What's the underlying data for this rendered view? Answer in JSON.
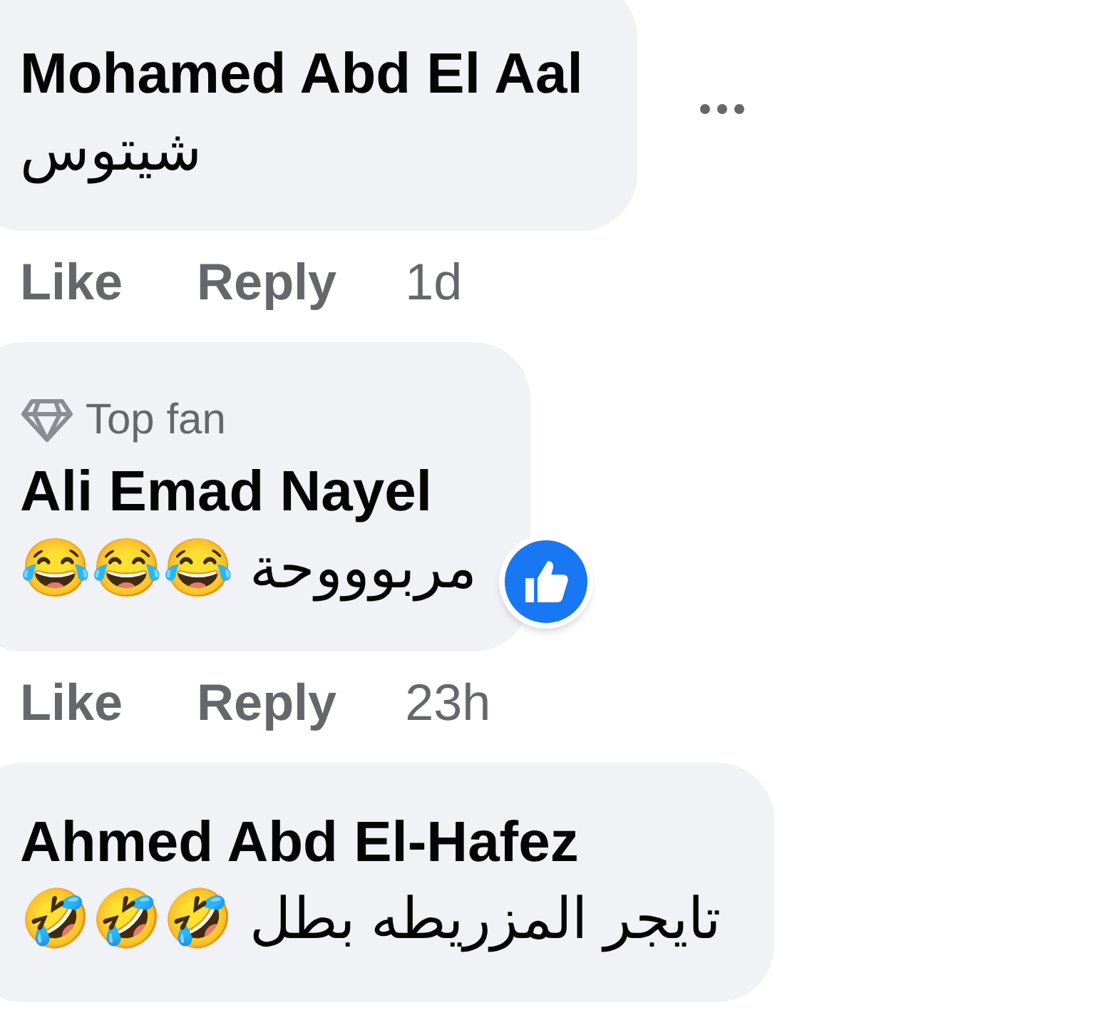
{
  "comments": [
    {
      "author": "Mohamed Abd El Aal",
      "text": "شيتوس",
      "reacted": false,
      "has_menu": true,
      "actions": [
        "Like",
        "Reply"
      ],
      "time": "1d"
    },
    {
      "author": "Ali Emad Nayel",
      "badge": "Top fan",
      "text": "مربوووحة 😂😂😂",
      "reacted": true,
      "has_menu": false,
      "actions": [
        "Like",
        "Reply"
      ],
      "time": "23h"
    },
    {
      "author": "Ahmed Abd El-Hafez",
      "text": "تايجر المزريطه بطل 🤣🤣🤣",
      "reacted": false,
      "has_menu": false
    }
  ]
}
